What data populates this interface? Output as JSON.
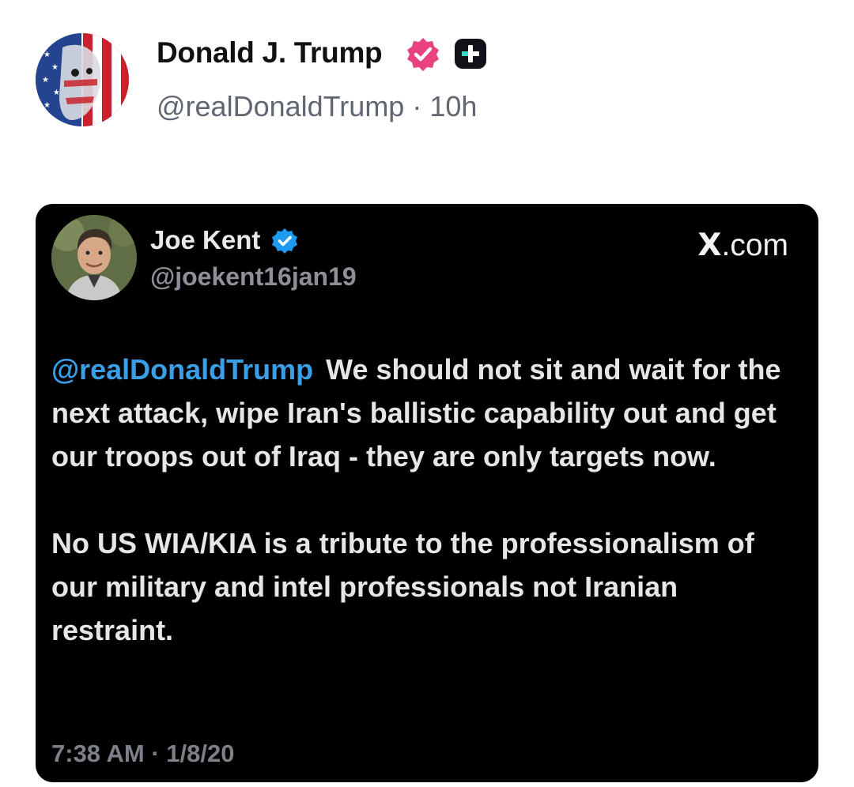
{
  "post": {
    "author_name": "Donald J. Trump",
    "author_handle": "@realDonaldTrump",
    "separator": "·",
    "time_ago": "10h"
  },
  "embedded_tweet": {
    "author_name": "Joe Kent",
    "author_handle": "@joekent16jan19",
    "source_x": "X",
    "source_suffix": ".com",
    "mention": "@realDonaldTrump",
    "paragraph_1": "We should not sit and wait for the next attack, wipe Iran's ballistic capability out and get our troops out of Iraq - they are only targets now.",
    "paragraph_2": "No US WIA/KIA is a tribute to the professionalism of our military and intel professionals not Iranian restraint.",
    "timestamp": "7:38 AM · 1/8/20"
  },
  "colors": {
    "verified_badge": "#e8437f",
    "x_verified_badge": "#1d9bf0",
    "mention": "#3a9fe6",
    "card_background": "#000000"
  },
  "icons": {
    "author_badge": "verified-badge-icon",
    "subscription_badge": "plus-square-icon",
    "tweet_badge": "x-verified-icon"
  }
}
